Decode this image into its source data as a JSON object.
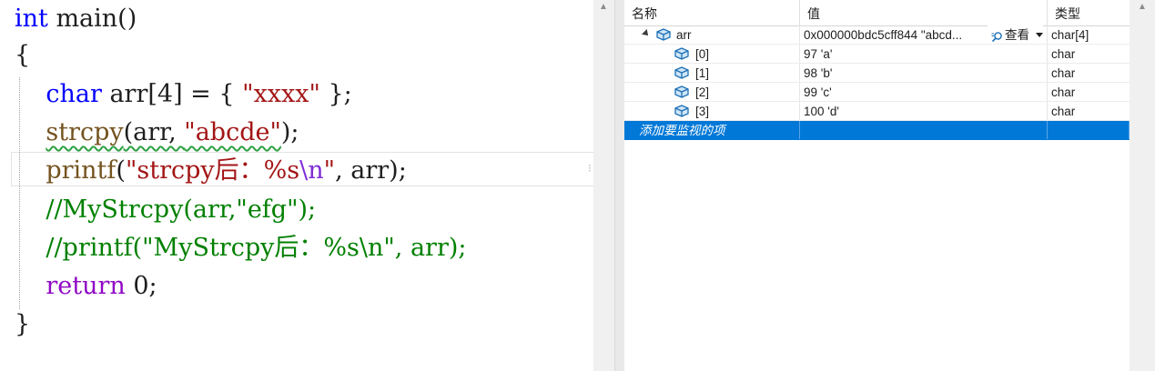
{
  "editor": {
    "lines": [
      {
        "id": "l1",
        "parts": [
          {
            "t": "int",
            "c": "kw"
          },
          {
            "t": " main()",
            "c": ""
          }
        ]
      },
      {
        "id": "l2",
        "parts": [
          {
            "t": "{",
            "c": ""
          }
        ]
      },
      {
        "id": "l3",
        "parts": [
          {
            "t": "    ",
            "c": ""
          },
          {
            "t": "char",
            "c": "ty"
          },
          {
            "t": " arr[4] = { ",
            "c": ""
          },
          {
            "t": "\"xxxx\"",
            "c": "str"
          },
          {
            "t": " };",
            "c": ""
          }
        ]
      },
      {
        "id": "l4",
        "parts": [
          {
            "t": "    ",
            "c": ""
          },
          {
            "t": "strcpy",
            "c": "fn squiggle"
          },
          {
            "t": "(arr, ",
            "c": "squiggle"
          },
          {
            "t": "\"abcde\"",
            "c": "str squiggle"
          },
          {
            "t": ");",
            "c": ""
          }
        ]
      },
      {
        "id": "l5",
        "parts": [
          {
            "t": "    ",
            "c": ""
          },
          {
            "t": "printf",
            "c": "fn"
          },
          {
            "t": "(",
            "c": ""
          },
          {
            "t": "\"strcpy后：%s",
            "c": "str"
          },
          {
            "t": "\\n",
            "c": "esc"
          },
          {
            "t": "\"",
            "c": "str"
          },
          {
            "t": ", arr);",
            "c": ""
          }
        ]
      },
      {
        "id": "l6",
        "parts": [
          {
            "t": "    ",
            "c": ""
          },
          {
            "t": "//MyStrcpy(arr,\"efg\");",
            "c": "cm"
          }
        ]
      },
      {
        "id": "l7",
        "parts": [
          {
            "t": "    ",
            "c": ""
          },
          {
            "t": "//printf(\"MyStrcpy后：%s\\n\", arr);",
            "c": "cm"
          }
        ]
      },
      {
        "id": "l8",
        "parts": [
          {
            "t": "    ",
            "c": ""
          },
          {
            "t": "return",
            "c": "ret"
          },
          {
            "t": " 0;",
            "c": ""
          }
        ]
      },
      {
        "id": "l9",
        "parts": [
          {
            "t": "}",
            "c": ""
          }
        ]
      }
    ]
  },
  "watch": {
    "columns": {
      "name": "名称",
      "value": "值",
      "type": "类型"
    },
    "root": {
      "name": "arr",
      "value": "0x000000bdc5cff844 \"abcd...",
      "view_label": "查看",
      "type": "char[4]"
    },
    "children": [
      {
        "name": "[0]",
        "value": "97 'a'",
        "type": "char"
      },
      {
        "name": "[1]",
        "value": "98 'b'",
        "type": "char"
      },
      {
        "name": "[2]",
        "value": "99 'c'",
        "type": "char"
      },
      {
        "name": "[3]",
        "value": "100 'd'",
        "type": "char"
      }
    ],
    "add_placeholder": "添加要监视的项"
  },
  "colors": {
    "selection": "#0078d7",
    "keyword": "#0000ff",
    "string": "#a31515",
    "comment": "#008000",
    "function": "#74531f",
    "control": "#8f08c4"
  },
  "icons": [
    "cube-icon",
    "expander-icon",
    "magnifier-icon",
    "dropdown-caret-icon",
    "scroll-up-icon"
  ]
}
